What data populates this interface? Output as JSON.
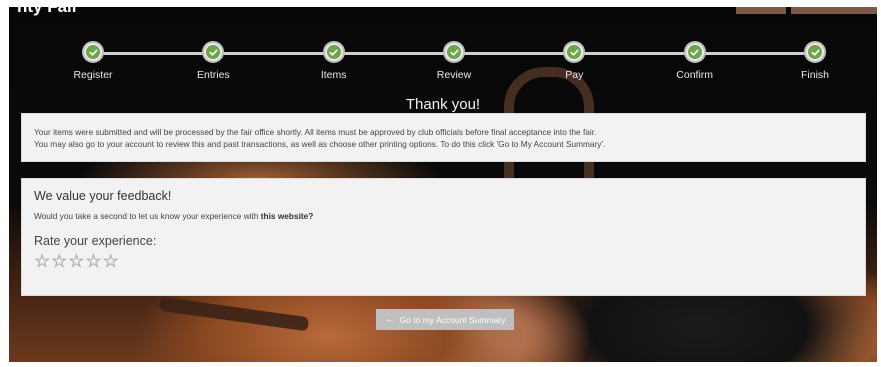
{
  "header": {
    "title": "nty Fair"
  },
  "steps": [
    {
      "label": "Register",
      "icon": "check-icon"
    },
    {
      "label": "Entries",
      "icon": "check-icon"
    },
    {
      "label": "Items",
      "icon": "check-icon"
    },
    {
      "label": "Review",
      "icon": "check-icon"
    },
    {
      "label": "Pay",
      "icon": "check-icon"
    },
    {
      "label": "Confirm",
      "icon": "check-icon"
    },
    {
      "label": "Finish",
      "icon": "check-icon"
    }
  ],
  "thank_you": "Thank you!",
  "info": {
    "line1": "Your items were submitted and will be processed by the fair office shortly. All items must be approved by club officials before final acceptance into the fair.",
    "line2": "You may also go to your account to review this and past transactions, as well as choose other printing options. To do this click 'Go to My Account Summary'."
  },
  "feedback": {
    "title": "We value your feedback!",
    "question_prefix": "Would you take a second to let us know your experience with ",
    "question_bold": "this website?",
    "rate_title": "Rate your experience:",
    "star_count": 5,
    "rating": 0
  },
  "account_button": {
    "label": "Go to my Account Summary",
    "icon": "arrow-left-icon"
  },
  "colors": {
    "check_green": "#6fa54a",
    "panel_bg": "#f2f2f2",
    "button_bg": "#bfbfbf"
  }
}
